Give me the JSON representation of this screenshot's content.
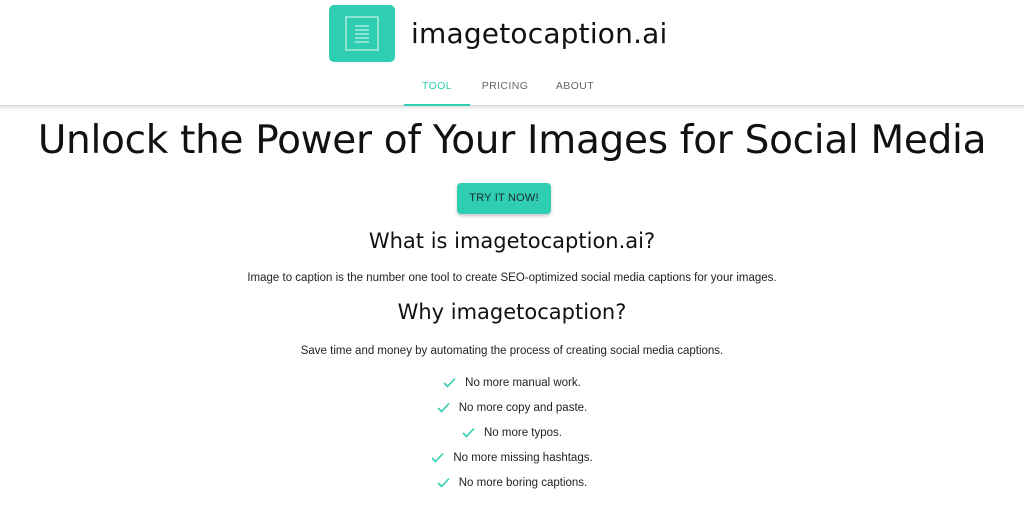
{
  "header": {
    "brand_name": "imagetocaption.ai",
    "logo_icon": "document-icon",
    "nav": {
      "tool": "TOOL",
      "pricing": "PRICING",
      "about": "ABOUT",
      "active": "TOOL"
    }
  },
  "hero": {
    "title": "Unlock the Power of Your Images for Social Media",
    "cta_label": "TRY IT NOW!"
  },
  "what": {
    "heading": "What is imagetocaption.ai?",
    "text": "Image to caption is the number one tool to create SEO-optimized social media captions for your images."
  },
  "why": {
    "heading": "Why imagetocaption?",
    "text": "Save time and money by automating the process of creating social media captions.",
    "benefits": [
      "No more manual work.",
      "No more copy and paste.",
      "No more typos.",
      "No more missing hashtags.",
      "No more boring captions."
    ],
    "benefit_icon": "check-icon"
  },
  "colors": {
    "accent": "#2fcdb1",
    "text": "#111111",
    "nav_inactive": "#666666"
  }
}
